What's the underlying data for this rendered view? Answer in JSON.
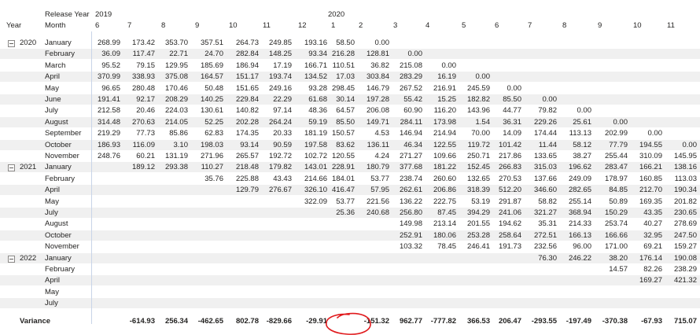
{
  "header": {
    "release_year_label": "Release Year",
    "year_label": "Year",
    "month_label": "Month",
    "year_groups": [
      "2019",
      "2020"
    ],
    "col_months": [
      "6",
      "7",
      "8",
      "9",
      "10",
      "11",
      "12",
      "1",
      "2",
      "3",
      "4",
      "5",
      "6",
      "7",
      "8",
      "9",
      "10",
      "11"
    ]
  },
  "groups": [
    {
      "year": "2020",
      "start": 0
    },
    {
      "year": "2021",
      "start": 11
    },
    {
      "year": "2022",
      "start": 19
    }
  ],
  "rows": [
    {
      "month": "January",
      "values": [
        "268.99",
        "173.42",
        "353.70",
        "357.51",
        "264.73",
        "249.85",
        "193.16",
        "58.50",
        "0.00"
      ]
    },
    {
      "month": "February",
      "values": [
        "36.09",
        "117.47",
        "22.71",
        "24.70",
        "282.84",
        "148.25",
        "93.34",
        "216.28",
        "128.81",
        "0.00"
      ]
    },
    {
      "month": "March",
      "values": [
        "95.52",
        "79.15",
        "129.95",
        "185.69",
        "186.94",
        "17.19",
        "166.71",
        "110.51",
        "36.82",
        "215.08",
        "0.00"
      ]
    },
    {
      "month": "April",
      "values": [
        "370.99",
        "338.93",
        "375.08",
        "164.57",
        "151.17",
        "193.74",
        "134.52",
        "17.03",
        "303.84",
        "283.29",
        "16.19",
        "0.00"
      ]
    },
    {
      "month": "May",
      "values": [
        "96.65",
        "280.48",
        "170.46",
        "50.48",
        "151.65",
        "249.16",
        "93.28",
        "298.45",
        "146.79",
        "267.52",
        "216.91",
        "245.59",
        "0.00"
      ]
    },
    {
      "month": "June",
      "values": [
        "191.41",
        "92.17",
        "208.29",
        "140.25",
        "229.84",
        "22.29",
        "61.68",
        "30.14",
        "197.28",
        "55.42",
        "15.25",
        "182.82",
        "85.50",
        "0.00"
      ]
    },
    {
      "month": "July",
      "values": [
        "212.58",
        "20.46",
        "224.03",
        "130.61",
        "140.82",
        "97.14",
        "48.36",
        "64.57",
        "206.08",
        "60.90",
        "116.20",
        "143.96",
        "44.77",
        "79.82",
        "0.00"
      ]
    },
    {
      "month": "August",
      "values": [
        "314.48",
        "270.63",
        "214.05",
        "52.25",
        "202.28",
        "264.24",
        "59.19",
        "85.50",
        "149.71",
        "284.11",
        "173.98",
        "1.54",
        "36.31",
        "229.26",
        "25.61",
        "0.00"
      ]
    },
    {
      "month": "September",
      "values": [
        "219.29",
        "77.73",
        "85.86",
        "62.83",
        "174.35",
        "20.33",
        "181.19",
        "150.57",
        "4.53",
        "146.94",
        "214.94",
        "70.00",
        "14.09",
        "174.44",
        "113.13",
        "202.99",
        "0.00"
      ]
    },
    {
      "month": "October",
      "values": [
        "186.93",
        "116.09",
        "3.10",
        "198.03",
        "93.14",
        "90.59",
        "197.58",
        "83.62",
        "136.11",
        "46.34",
        "122.55",
        "119.72",
        "101.42",
        "11.44",
        "58.12",
        "77.79",
        "194.55",
        "0.00"
      ]
    },
    {
      "month": "November",
      "values": [
        "248.76",
        "60.21",
        "131.19",
        "271.96",
        "265.57",
        "192.72",
        "102.72",
        "120.55",
        "4.24",
        "271.27",
        "109.66",
        "250.71",
        "217.86",
        "133.65",
        "38.27",
        "255.44",
        "310.09",
        "145.95"
      ]
    },
    {
      "month": "January",
      "values": [
        "",
        "189.12",
        "293.38",
        "110.27",
        "218.48",
        "179.82",
        "143.01",
        "228.91",
        "180.79",
        "377.68",
        "181.22",
        "152.45",
        "266.83",
        "315.03",
        "196.62",
        "283.47",
        "166.21",
        "138.16"
      ]
    },
    {
      "month": "February",
      "values": [
        "",
        "",
        "",
        "35.76",
        "225.88",
        "43.43",
        "214.66",
        "184.01",
        "53.77",
        "238.74",
        "260.60",
        "132.65",
        "270.53",
        "137.66",
        "249.09",
        "178.97",
        "160.85",
        "113.03"
      ]
    },
    {
      "month": "April",
      "values": [
        "",
        "",
        "",
        "",
        "129.79",
        "276.67",
        "326.10",
        "416.47",
        "57.95",
        "262.61",
        "206.86",
        "318.39",
        "512.20",
        "346.60",
        "282.65",
        "84.85",
        "212.70",
        "190.34"
      ]
    },
    {
      "month": "May",
      "values": [
        "",
        "",
        "",
        "",
        "",
        "",
        "322.09",
        "53.77",
        "221.56",
        "136.22",
        "222.75",
        "53.19",
        "291.87",
        "58.82",
        "255.14",
        "50.89",
        "169.35",
        "201.82"
      ]
    },
    {
      "month": "July",
      "values": [
        "",
        "",
        "",
        "",
        "",
        "",
        "",
        "25.36",
        "240.68",
        "256.80",
        "87.45",
        "394.29",
        "241.06",
        "321.27",
        "368.94",
        "150.29",
        "43.35",
        "230.65"
      ]
    },
    {
      "month": "August",
      "values": [
        "",
        "",
        "",
        "",
        "",
        "",
        "",
        "",
        "",
        "149.98",
        "213.14",
        "201.55",
        "194.62",
        "35.31",
        "214.33",
        "253.74",
        "40.27",
        "278.69"
      ]
    },
    {
      "month": "October",
      "values": [
        "",
        "",
        "",
        "",
        "",
        "",
        "",
        "",
        "",
        "252.91",
        "180.06",
        "253.28",
        "258.64",
        "272.51",
        "166.13",
        "166.66",
        "32.95",
        "247.50"
      ]
    },
    {
      "month": "November",
      "values": [
        "",
        "",
        "",
        "",
        "",
        "",
        "",
        "",
        "",
        "103.32",
        "78.45",
        "246.41",
        "191.73",
        "232.56",
        "96.00",
        "171.00",
        "69.21",
        "159.27"
      ]
    },
    {
      "month": "January",
      "values": [
        "",
        "",
        "",
        "",
        "",
        "",
        "",
        "",
        "",
        "",
        "",
        "",
        "",
        "76.30",
        "246.22",
        "38.20",
        "176.14",
        "190.08"
      ]
    },
    {
      "month": "February",
      "values": [
        "",
        "",
        "",
        "",
        "",
        "",
        "",
        "",
        "",
        "",
        "",
        "",
        "",
        "",
        "",
        "14.57",
        "82.26",
        "238.29"
      ]
    },
    {
      "month": "April",
      "values": [
        "",
        "",
        "",
        "",
        "",
        "",
        "",
        "",
        "",
        "",
        "",
        "",
        "",
        "",
        "",
        "",
        "169.27",
        "421.32"
      ]
    },
    {
      "month": "May",
      "values": [
        "",
        "",
        "",
        "",
        "",
        "",
        "",
        "",
        "",
        "",
        "",
        "",
        "",
        "",
        "",
        "",
        "",
        ""
      ]
    },
    {
      "month": "July",
      "values": [
        "",
        "",
        "",
        "",
        "",
        "",
        "",
        "",
        "",
        "",
        "",
        "",
        "",
        "",
        "",
        "",
        "",
        ""
      ]
    }
  ],
  "variance": {
    "label": "Variance",
    "values": [
      "",
      "-614.93",
      "256.34",
      "-462.65",
      "802.78",
      "-829.66",
      "-29.91",
      "",
      "-151.32",
      "962.77",
      "-777.82",
      "366.53",
      "206.47",
      "-293.55",
      "-197.49",
      "-370.38",
      "-67.93",
      "715.07"
    ]
  },
  "annotation_color": "#e0191c"
}
